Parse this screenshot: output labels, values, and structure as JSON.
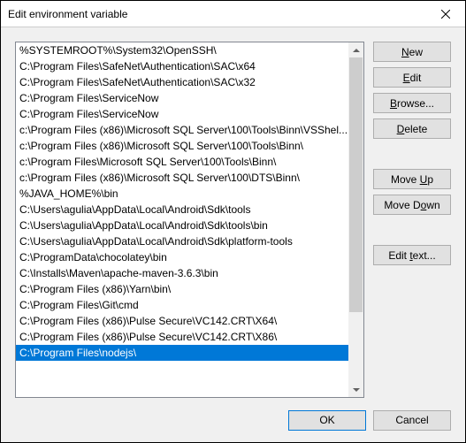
{
  "window": {
    "title": "Edit environment variable"
  },
  "list": {
    "items": [
      "%SYSTEMROOT%\\System32\\OpenSSH\\",
      "C:\\Program Files\\SafeNet\\Authentication\\SAC\\x64",
      "C:\\Program Files\\SafeNet\\Authentication\\SAC\\x32",
      "C:\\Program Files\\ServiceNow",
      "C:\\Program Files\\ServiceNow",
      "c:\\Program Files (x86)\\Microsoft SQL Server\\100\\Tools\\Binn\\VSShel...",
      "c:\\Program Files (x86)\\Microsoft SQL Server\\100\\Tools\\Binn\\",
      "c:\\Program Files\\Microsoft SQL Server\\100\\Tools\\Binn\\",
      "c:\\Program Files (x86)\\Microsoft SQL Server\\100\\DTS\\Binn\\",
      "%JAVA_HOME%\\bin",
      "C:\\Users\\agulia\\AppData\\Local\\Android\\Sdk\\tools",
      "C:\\Users\\agulia\\AppData\\Local\\Android\\Sdk\\tools\\bin",
      "C:\\Users\\agulia\\AppData\\Local\\Android\\Sdk\\platform-tools",
      "C:\\ProgramData\\chocolatey\\bin",
      "C:\\Installs\\Maven\\apache-maven-3.6.3\\bin",
      "C:\\Program Files (x86)\\Yarn\\bin\\",
      "C:\\Program Files\\Git\\cmd",
      "C:\\Program Files (x86)\\Pulse Secure\\VC142.CRT\\X64\\",
      "C:\\Program Files (x86)\\Pulse Secure\\VC142.CRT\\X86\\",
      "C:\\Program Files\\nodejs\\"
    ],
    "selected_index": 19
  },
  "buttons": {
    "new": "New",
    "edit": "Edit",
    "browse": "Browse...",
    "delete": "Delete",
    "move_up": "Move Up",
    "move_down": "Move Down",
    "edit_text": "Edit text...",
    "ok": "OK",
    "cancel": "Cancel"
  }
}
